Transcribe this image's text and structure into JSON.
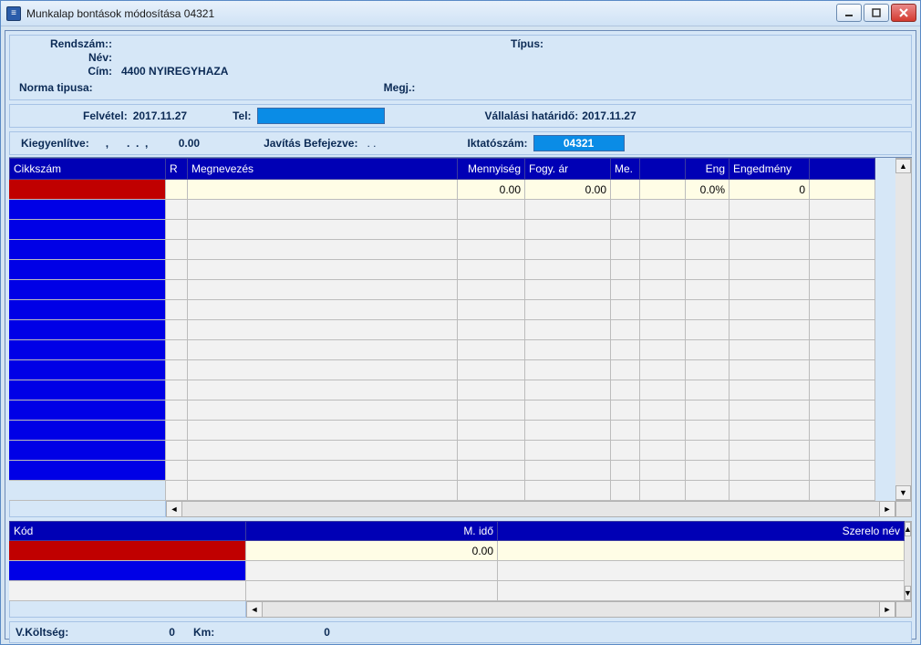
{
  "window": {
    "title": "Munkalap bontások módosítása    04321"
  },
  "header": {
    "rendszam_label": "Rendszám::",
    "nev_label": "Név:",
    "cim_label": "Cím:",
    "cim_value": "4400 NYIREGYHAZA",
    "tipus_label": "Típus:",
    "norma_label": "Norma tipusa:",
    "megj_label": "Megj.:"
  },
  "bar2": {
    "felvetel_label": "Felvétel:",
    "felvetel_value": "2017.11.27",
    "tel_label": "Tel:",
    "tel_value": "",
    "hatarido_label": "Vállalási határidő:",
    "hatarido_value": "2017.11.27"
  },
  "bar3": {
    "kiegy_label": "Kiegyenlítve:",
    "kiegy_value": ",      .  .  ,          0.00",
    "javitas_label": "Javítás Befejezve:",
    "javitas_value": ".  .",
    "iktato_label": "Iktatószám:",
    "iktato_value": "04321"
  },
  "grid": {
    "headers": {
      "cikkszam": "Cikkszám",
      "r": "R",
      "megnevezes": "Megnevezés",
      "mennyiseg": "Mennyiség",
      "fogyar": "Fogy. ár",
      "me": "Me.",
      "bl1": "",
      "eng": "Eng",
      "engedmeny": "Engedmény",
      "bl2": ""
    },
    "row1": {
      "mennyiseg": "0.00",
      "fogyar": "0.00",
      "eng": "0.0%",
      "engedmeny": "0"
    }
  },
  "lower": {
    "headers": {
      "kod": "Kód",
      "mido": "M. idő",
      "szerelo": "Szerelo név"
    },
    "row1_mido": "0.00"
  },
  "footer": {
    "vkoltseg_label": "V.Költség:",
    "vkoltseg_value": "0",
    "km_label": "Km:",
    "km_value": "0"
  }
}
